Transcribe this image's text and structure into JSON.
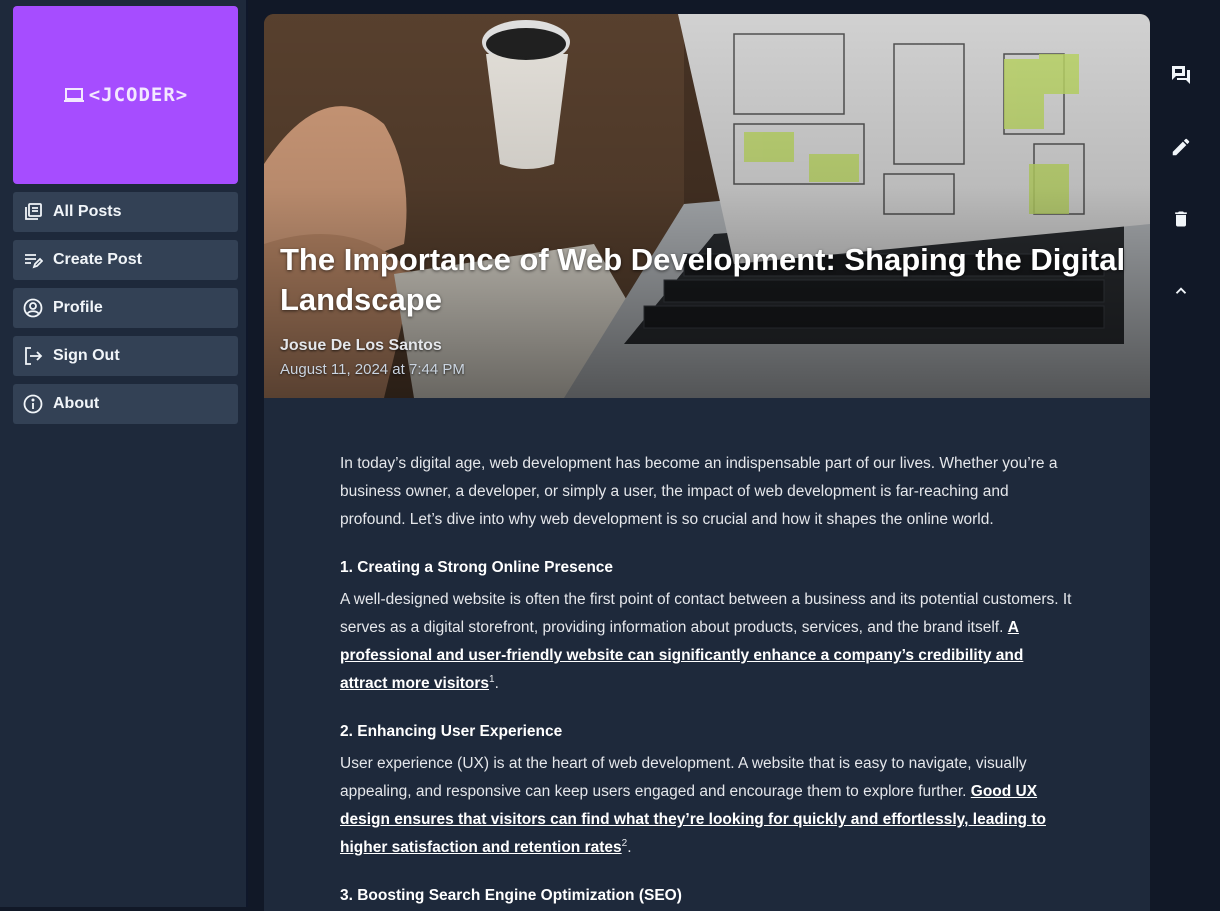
{
  "sidebar": {
    "logo_text": "<JCODER>",
    "items": [
      {
        "label": "All Posts",
        "icon": "library-icon"
      },
      {
        "label": "Create Post",
        "icon": "edit-note-icon"
      },
      {
        "label": "Profile",
        "icon": "account-circle-icon"
      },
      {
        "label": "Sign Out",
        "icon": "logout-icon"
      },
      {
        "label": "About",
        "icon": "info-icon"
      }
    ]
  },
  "post": {
    "title": "The Importance of Web Development: Shaping the Digital Landscape",
    "author": "Josue De Los Santos",
    "date": "August 11, 2024 at 7:44 PM",
    "intro": "In today’s digital age, web development has become an indispensable part of our lives. Whether you’re a business owner, a developer, or simply a user, the impact of web development is far-reaching and profound. Let’s dive into why web development is so crucial and how it shapes the online world.",
    "sections": [
      {
        "heading": "1. Creating a Strong Online Presence",
        "text": "A well-designed website is often the first point of contact between a business and its potential customers. It serves as a digital storefront, providing information about products, services, and the brand itself. ",
        "link": "A professional and user-friendly website can significantly enhance a company’s credibility and attract more visitors",
        "sup": "1",
        "tail": "."
      },
      {
        "heading": "2. Enhancing User Experience",
        "text": "User experience (UX) is at the heart of web development. A website that is easy to navigate, visually appealing, and responsive can keep users engaged and encourage them to explore further. ",
        "link": "Good UX design ensures that visitors can find what they’re looking for quickly and effortlessly, leading to higher satisfaction and retention rates",
        "sup": "2",
        "tail": "."
      },
      {
        "heading": "3. Boosting Search Engine Optimization (SEO)"
      }
    ]
  },
  "actions": [
    "comments-icon",
    "edit-icon",
    "delete-icon",
    "collapse-icon"
  ],
  "colors": {
    "accent": "#a64dff",
    "background": "#111827",
    "panel": "#1e293b",
    "nav_item": "#334155"
  }
}
